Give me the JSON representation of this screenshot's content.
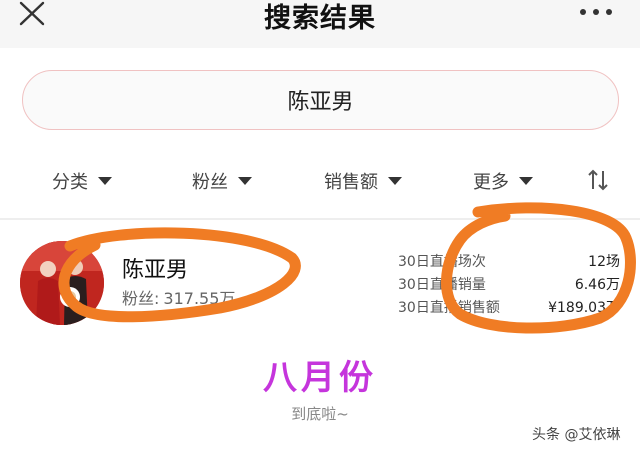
{
  "header": {
    "title": "搜索结果",
    "close_icon": "close-icon",
    "more_icon": "more-dots-icon"
  },
  "search": {
    "query": "陈亚男"
  },
  "filters": [
    {
      "label": "分类"
    },
    {
      "label": "粉丝"
    },
    {
      "label": "销售额"
    },
    {
      "label": "更多"
    }
  ],
  "sort_icon": "sort-icon",
  "result": {
    "name": "陈亚男",
    "fans_label": "粉丝:",
    "fans_value": "317.55万",
    "stats": [
      {
        "label": "30日直播场次",
        "value": "12场"
      },
      {
        "label": "30日直播销量",
        "value": "6.46万"
      },
      {
        "label": "30日直播销售额",
        "value": "¥189.03万"
      }
    ]
  },
  "annotation": {
    "month_text": "八月份",
    "marker_color": "#f07c24",
    "month_color": "#c535dc"
  },
  "footer": {
    "end_text": "到底啦~",
    "watermark": "头条 @艾依琳"
  }
}
